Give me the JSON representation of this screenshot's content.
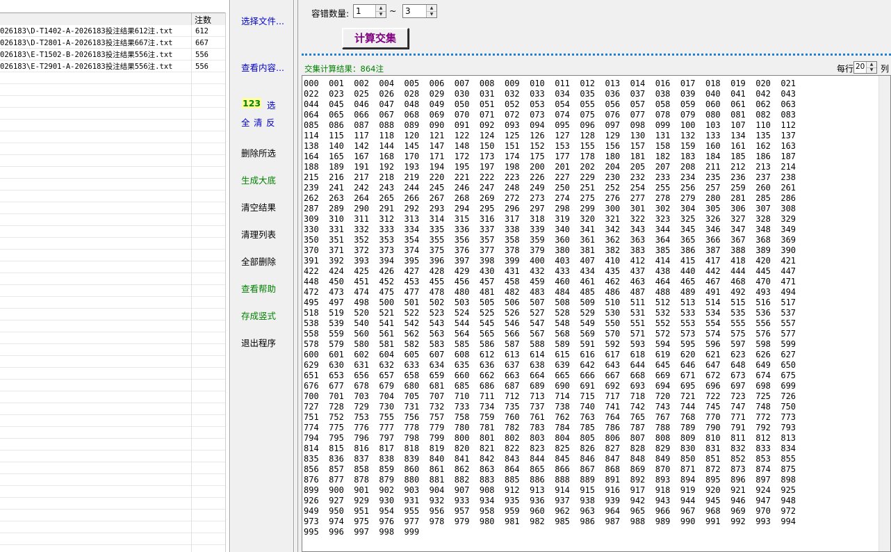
{
  "file_list": {
    "count_header": "注数",
    "rows": [
      {
        "name": "026183\\D-T1402-A-2026183投注结果612注.txt",
        "count": "612"
      },
      {
        "name": "026183\\D-T2801-A-2026183投注结果667注.txt",
        "count": "667"
      },
      {
        "name": "026183\\E-T1502-B-2026183投注结果556注.txt",
        "count": "556"
      },
      {
        "name": "026183\\E-T2901-A-2026183投注结果556注.txt",
        "count": "556"
      }
    ]
  },
  "buttons": {
    "select_files": "选择文件...",
    "view_content": "查看内容...",
    "sel_123": "123",
    "sel_select": "选",
    "sel_all": "全",
    "sel_clear": "清",
    "sel_invert": "反",
    "delete_selected": "删除所选",
    "generate_base": "生成大底",
    "clear_results": "清空结果",
    "clean_list": "清理列表",
    "delete_all": "全部删除",
    "view_help": "查看帮助",
    "save_vertical": "存成竖式",
    "exit": "退出程序",
    "calculate": "计算交集"
  },
  "tolerance": {
    "label": "容错数量:",
    "min": "1",
    "sep": "~",
    "max": "3"
  },
  "result": {
    "label": "交集计算结果：864注",
    "per_row_label": "每行",
    "per_row_value": "20",
    "col_label": "列",
    "numbers": "000 001 002 004 005 006 007 008 009 010 011 012 013 014 016 017 018 019 020 021 022 023 025 026 028 029 030 031 032 033 034 035 036 037 038 039 040 041 042 043 044 045 046 047 048 049 050 051 052 053 054 055 056 057 058 059 060 061 062 063 064 065 066 067 068 069 070 071 072 073 074 075 076 077 078 079 080 081 082 083 085 086 087 088 089 090 091 092 093 094 095 096 097 098 099 100 103 107 110 112 114 115 117 118 120 121 122 124 125 126 127 128 129 130 131 132 133 134 135 137 138 140 142 144 145 147 148 150 151 152 153 155 156 157 158 159 160 161 162 163 164 165 167 168 170 171 172 173 174 175 177 178 180 181 182 183 184 185 186 187 188 189 191 192 193 194 195 197 198 200 201 202 204 205 207 208 211 212 213 214 215 216 217 218 219 220 221 222 223 226 227 229 230 232 233 234 235 236 237 238 239 241 242 243 244 245 246 247 248 249 250 251 252 254 255 256 257 259 260 261 262 263 264 265 266 267 268 269 272 273 274 275 276 277 278 279 280 281 285 286 287 289 290 291 292 293 294 295 296 297 298 299 300 301 302 304 305 306 307 308 309 310 311 312 313 314 315 316 317 318 319 320 321 322 323 325 326 327 328 329 330 331 332 333 334 335 336 337 338 339 340 341 342 343 344 345 346 347 348 349 350 351 352 353 354 355 356 357 358 359 360 361 362 363 364 365 366 367 368 369 370 371 372 373 374 375 376 377 378 379 380 381 382 383 385 386 387 388 389 390 391 392 393 394 395 396 397 398 399 400 403 407 410 412 414 415 417 418 420 421 422 424 425 426 427 428 429 430 431 432 433 434 435 437 438 440 442 444 445 447 448 450 451 452 453 455 456 457 458 459 460 461 462 463 464 465 467 468 470 471 472 473 474 475 477 478 480 481 482 483 484 485 486 487 488 489 491 492 493 494 495 497 498 500 501 502 503 505 506 507 508 509 510 511 512 513 514 515 516 517 518 519 520 521 522 523 524 525 526 527 528 529 530 531 532 533 534 535 536 537 538 539 540 541 542 543 544 545 546 547 548 549 550 551 552 553 554 555 556 557 558 559 560 561 562 563 564 565 566 567 568 569 570 571 572 573 574 575 576 577 578 579 580 581 582 583 585 586 587 588 589 591 592 593 594 595 596 597 598 599 600 601 602 604 605 607 608 612 613 614 615 616 617 618 619 620 621 623 626 627 629 630 631 632 633 634 635 636 637 638 639 642 643 644 645 646 647 648 649 650 651 653 656 657 658 659 660 662 663 664 665 666 667 668 669 671 672 673 674 675 676 677 678 679 680 681 685 686 687 689 690 691 692 693 694 695 696 697 698 699 700 701 703 704 705 707 710 711 712 713 714 715 717 718 720 721 722 723 725 726 727 728 729 730 731 732 733 734 735 737 738 740 741 742 743 744 745 747 748 750 751 752 753 755 756 757 758 759 760 761 762 763 764 765 767 768 770 771 772 773 774 775 776 777 778 779 780 781 782 783 784 785 786 787 788 789 790 791 792 793 794 795 796 797 798 799 800 801 802 803 804 805 806 807 808 809 810 811 812 813 814 815 816 817 818 819 820 821 822 823 825 826 827 828 829 830 831 832 833 834 835 836 837 838 839 840 841 842 843 844 845 846 847 848 849 850 851 852 853 855 856 857 858 859 860 861 862 863 864 865 866 867 868 869 870 871 872 873 874 875 876 877 878 879 880 881 882 883 885 886 888 889 891 892 893 894 895 896 897 898 899 900 901 902 903 904 907 908 912 913 914 915 916 917 918 919 920 921 924 925 926 927 929 930 931 932 933 934 935 936 937 938 939 942 943 944 945 946 947 948 949 950 951 954 955 956 957 958 959 960 962 963 964 965 966 967 968 969 970 972 973 974 975 976 977 978 979 980 981 982 985 986 987 988 989 990 991 992 993 994 995 996 997 998 999",
    "items_per_line": 20
  }
}
